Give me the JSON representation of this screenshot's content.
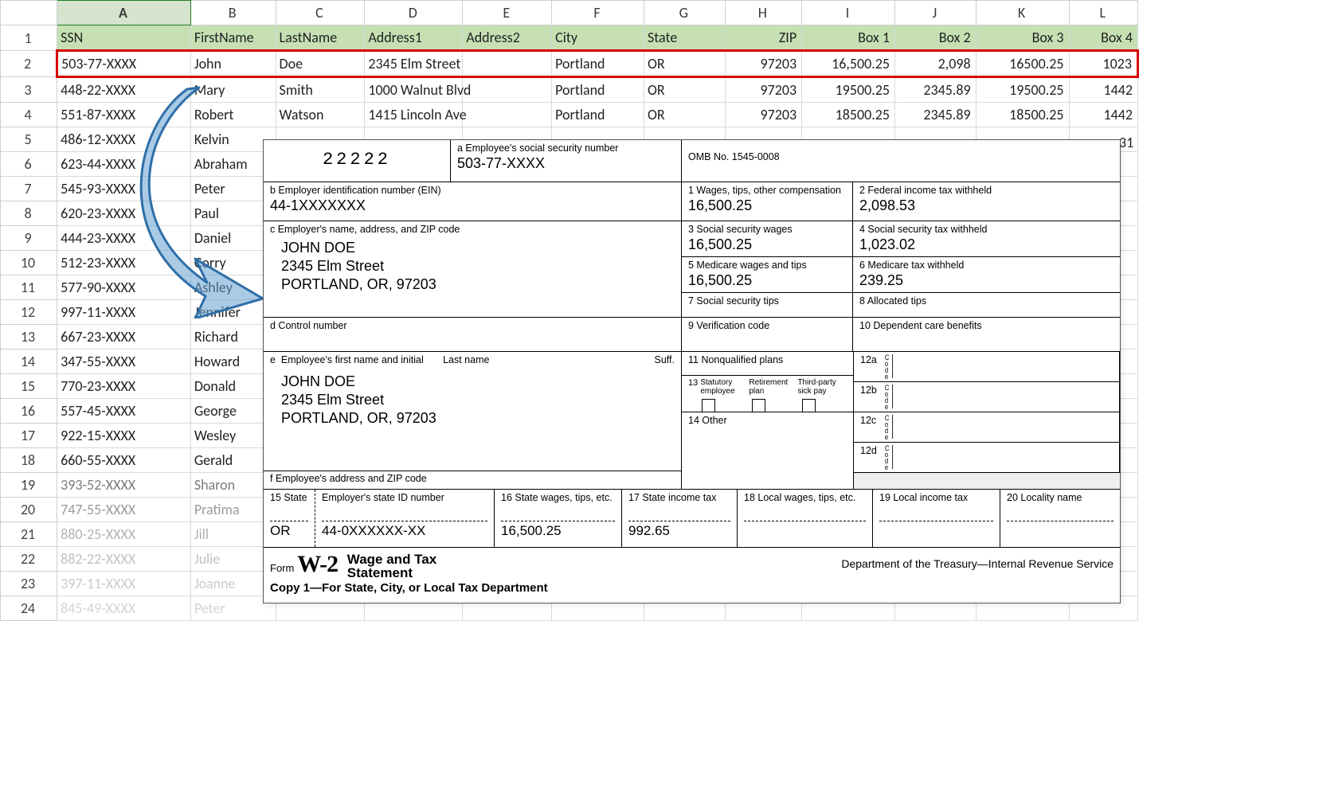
{
  "columns": [
    "A",
    "B",
    "C",
    "D",
    "E",
    "F",
    "G",
    "H",
    "I",
    "J",
    "K",
    "L"
  ],
  "selected_column": "A",
  "header": {
    "A": "SSN",
    "B": "FirstName",
    "C": "LastName",
    "D": "Address1",
    "E": "Address2",
    "F": "City",
    "G": "State",
    "H": "ZIP",
    "I": "Box 1",
    "J": "Box 2",
    "K": "Box 3",
    "L": "Box 4"
  },
  "rows": [
    {
      "n": 2,
      "A": "503-77-XXXX",
      "B": "John",
      "C": "Doe",
      "D": "2345 Elm Street",
      "E": "",
      "F": "Portland",
      "G": "OR",
      "H": "97203",
      "I": "16,500.25",
      "J": "2,098",
      "K": "16500.25",
      "L": "1023"
    },
    {
      "n": 3,
      "A": "448-22-XXXX",
      "B": "Mary",
      "C": "Smith",
      "D": "1000 Walnut Blvd",
      "E": "",
      "F": "Portland",
      "G": "OR",
      "H": "97203",
      "I": "19500.25",
      "J": "2345.89",
      "K": "19500.25",
      "L": "1442"
    },
    {
      "n": 4,
      "A": "551-87-XXXX",
      "B": "Robert",
      "C": "Watson",
      "D": "1415 Lincoln Ave",
      "E": "",
      "F": "Portland",
      "G": "OR",
      "H": "97203",
      "I": "18500.25",
      "J": "2345.89",
      "K": "18500.25",
      "L": "1442"
    },
    {
      "n": 5,
      "A": "486-12-XXXX",
      "B": "Kelvin"
    },
    {
      "n": 6,
      "A": "623-44-XXXX",
      "B": "Abraham"
    },
    {
      "n": 7,
      "A": "545-93-XXXX",
      "B": "Peter"
    },
    {
      "n": 8,
      "A": "620-23-XXXX",
      "B": "Paul"
    },
    {
      "n": 9,
      "A": "444-23-XXXX",
      "B": "Daniel"
    },
    {
      "n": 10,
      "A": "512-23-XXXX",
      "B": "Corry"
    },
    {
      "n": 11,
      "A": "577-90-XXXX",
      "B": "Ashley"
    },
    {
      "n": 12,
      "A": "997-11-XXXX",
      "B": "Jennifer"
    },
    {
      "n": 13,
      "A": "667-23-XXXX",
      "B": "Richard"
    },
    {
      "n": 14,
      "A": "347-55-XXXX",
      "B": "Howard"
    },
    {
      "n": 15,
      "A": "770-23-XXXX",
      "B": "Donald"
    },
    {
      "n": 16,
      "A": "557-45-XXXX",
      "B": "George"
    },
    {
      "n": 17,
      "A": "922-15-XXXX",
      "B": "Wesley"
    },
    {
      "n": 18,
      "A": "660-55-XXXX",
      "B": "Gerald"
    },
    {
      "n": 19,
      "A": "393-52-XXXX",
      "B": "Sharon"
    },
    {
      "n": 20,
      "A": "747-55-XXXX",
      "B": "Pratima"
    },
    {
      "n": 21,
      "A": "880-25-XXXX",
      "B": "Jill"
    },
    {
      "n": 22,
      "A": "882-22-XXXX",
      "B": "Julie"
    },
    {
      "n": 23,
      "A": "397-11-XXXX",
      "B": "Joanne"
    },
    {
      "n": 24,
      "A": "845-49-XXXX",
      "B": "Peter"
    }
  ],
  "rightmost_partial": "31",
  "w2": {
    "code22222": "22222",
    "a_lbl": "a  Employee's social security number",
    "a_val": "503-77-XXXX",
    "omb": "OMB No. 1545-0008",
    "b_lbl": "b  Employer identification number (EIN)",
    "b_val": "44-1XXXXXXX",
    "c_lbl": "c  Employer's name, address, and ZIP code",
    "c_name": "JOHN DOE",
    "c_addr": "2345 Elm Street",
    "c_city": "PORTLAND, OR, 97203",
    "d_lbl": "d  Control number",
    "e_lbl": "e  Employee's first name and initial       Last name",
    "e_suff": "Suff.",
    "e_name": "JOHN DOE",
    "e_addr": "2345 Elm Street",
    "e_city": "PORTLAND, OR, 97203",
    "f_lbl": "f   Employee's address and ZIP code",
    "box1_lbl": "1   Wages, tips, other compensation",
    "box1_val": "16,500.25",
    "box2_lbl": "2   Federal income tax withheld",
    "box2_val": "2,098.53",
    "box3_lbl": "3   Social security wages",
    "box3_val": "16,500.25",
    "box4_lbl": "4   Social security tax withheld",
    "box4_val": "1,023.02",
    "box5_lbl": "5   Medicare wages and tips",
    "box5_val": "16,500.25",
    "box6_lbl": "6   Medicare tax withheld",
    "box6_val": "239.25",
    "box7_lbl": "7   Social security tips",
    "box8_lbl": "8   Allocated tips",
    "box9_lbl": "9   Verification code",
    "box10_lbl": "10   Dependent care benefits",
    "box11_lbl": "11   Nonqualified plans",
    "box12a": "12a",
    "box12b": "12b",
    "box12c": "12c",
    "box12d": "12d",
    "box12code": "C\no\nd\ne",
    "box13_lbl": "13",
    "box13_a": "Statutory\nemployee",
    "box13_b": "Retirement\nplan",
    "box13_c": "Third-party\nsick pay",
    "box14_lbl": "14   Other",
    "box15_lbl": "15  State",
    "box15_state": "OR",
    "emp_stateid_lbl": "Employer's state ID number",
    "emp_stateid_val": "44-0XXXXXX-XX",
    "box16_lbl": "16   State wages, tips, etc.",
    "box16_val": "16,500.25",
    "box17_lbl": "17   State income tax",
    "box17_val": "992.65",
    "box18_lbl": "18   Local wages, tips, etc.",
    "box19_lbl": "19   Local income tax",
    "box20_lbl": "20   Locality name",
    "form_word": "Form",
    "form_code": "W-2",
    "form_title": "Wage and Tax\nStatement",
    "copy1": "Copy 1—For State, City, or Local Tax Department",
    "dept": "Department of the Treasury—Internal Revenue Service"
  }
}
